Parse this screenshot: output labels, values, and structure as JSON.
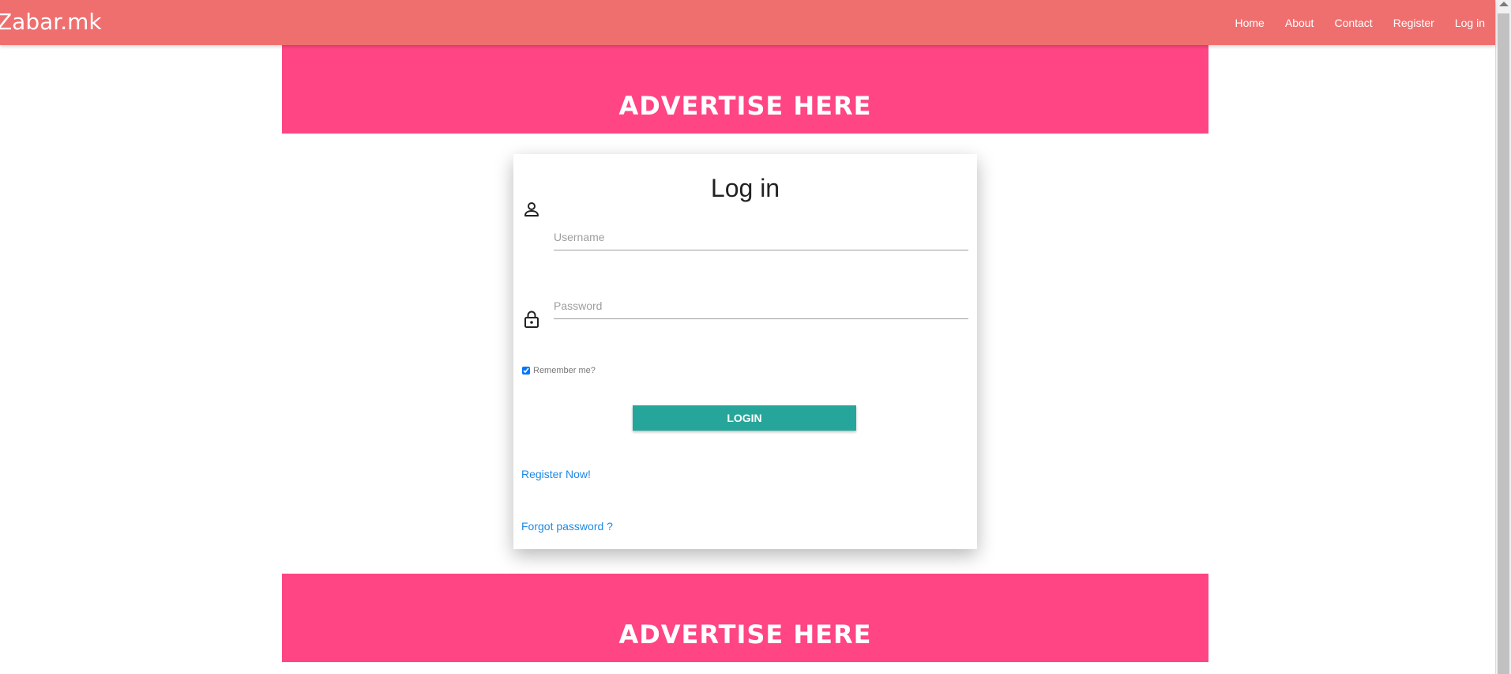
{
  "navbar": {
    "brand": "Zabar.mk",
    "links": [
      "Home",
      "About",
      "Contact",
      "Register",
      "Log in"
    ]
  },
  "ads": {
    "top": "ADVERTISE HERE",
    "bottom": "ADVERTISE HERE"
  },
  "login": {
    "title": "Log in",
    "username_placeholder": "Username",
    "password_placeholder": "Password",
    "remember_label": "Remember me?",
    "remember_checked": true,
    "submit_label": "LOGIN",
    "register_link": "Register Now!",
    "forgot_link": "Forgot password ?"
  },
  "colors": {
    "navbar": "#ef6f6f",
    "ad_banner": "#ff4584",
    "button": "#26a69a",
    "link": "#1e88e5"
  },
  "icons": [
    "person-icon",
    "lock-icon"
  ]
}
